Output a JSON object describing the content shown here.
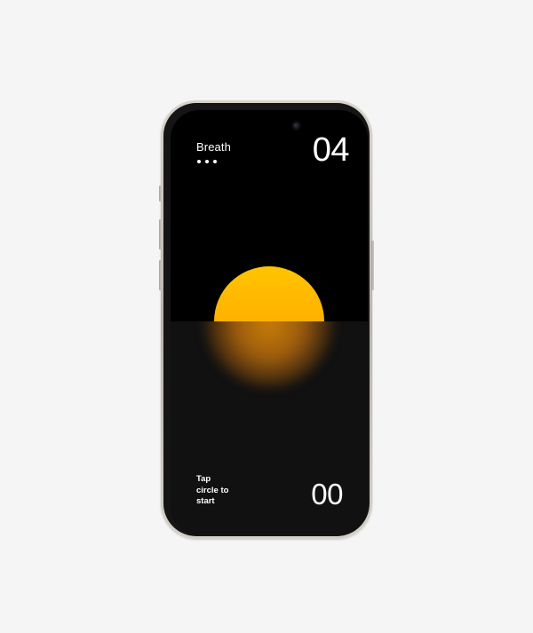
{
  "app": {
    "title": "Breath",
    "indicator_dots": 3
  },
  "counters": {
    "top": "04",
    "bottom": "00"
  },
  "instruction": {
    "line1": "Tap",
    "line2": "circle to",
    "line3": "start"
  },
  "colors": {
    "background": "#f5f5f5",
    "screen": "#000000",
    "lower_panel": "#111111",
    "sun": "#ffb300",
    "reflection": "#c8720c",
    "text": "#ffffff"
  },
  "icons": {
    "front_camera": "camera-lens",
    "page_dots": "ellipsis-dots"
  }
}
